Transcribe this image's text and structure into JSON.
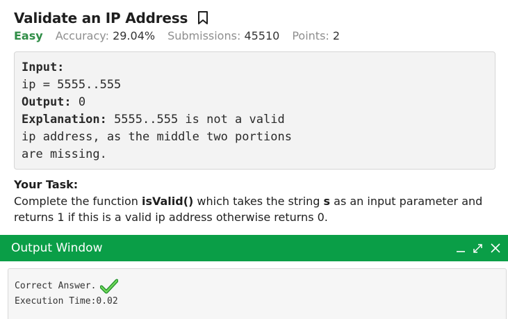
{
  "problem": {
    "title": "Validate an IP Address",
    "difficulty": "Easy",
    "accuracy_label": "Accuracy:",
    "accuracy_value": "29.04%",
    "submissions_label": "Submissions:",
    "submissions_value": "45510",
    "points_label": "Points:",
    "points_value": "2"
  },
  "example": {
    "input_label": "Input:",
    "input_value": "ip = 5555..555",
    "output_label": "Output:",
    "output_value": " 0",
    "explanation_label": "Explanation:",
    "explanation_line1": " 5555..555 is not a valid",
    "explanation_line2": "ip address, as the middle two portions",
    "explanation_line3": "are missing."
  },
  "task": {
    "heading": "Your Task:",
    "text_part1": "Complete the function ",
    "function_name": "isValid()",
    "text_part2": " which takes the string ",
    "param_name": "s",
    "text_part3": " as an input parameter and returns 1 if this is a valid ip address otherwise returns 0."
  },
  "output_window": {
    "title": "Output Window",
    "result_text": "Correct Answer.",
    "execution_time": "Execution Time:0.02"
  },
  "colors": {
    "accent_green": "#0a9e47",
    "easy_green": "#2f8d46"
  },
  "icons": {
    "bookmark": "bookmark-icon",
    "minimize": "minimize-icon",
    "expand": "expand-icon",
    "close": "close-icon",
    "check": "checkmark-icon"
  }
}
